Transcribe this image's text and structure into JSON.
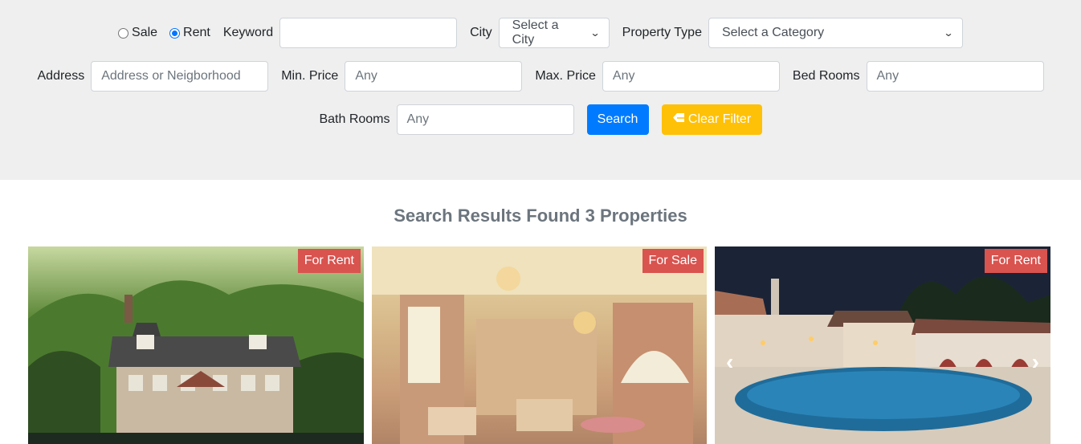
{
  "filters": {
    "sale_label": "Sale",
    "rent_label": "Rent",
    "selected_listing": "Rent",
    "keyword_label": "Keyword",
    "keyword_value": "",
    "city_label": "City",
    "city_selected": "Select a City",
    "property_type_label": "Property Type",
    "property_type_selected": "Select a Category",
    "address_label": "Address",
    "address_placeholder": "Address or Neigborhood",
    "min_price_label": "Min. Price",
    "min_price_placeholder": "Any",
    "max_price_label": "Max. Price",
    "max_price_placeholder": "Any",
    "bed_rooms_label": "Bed Rooms",
    "bed_rooms_placeholder": "Any",
    "bath_rooms_label": "Bath Rooms",
    "bath_rooms_placeholder": "Any",
    "search_button": "Search",
    "clear_button": "Clear Filter"
  },
  "results": {
    "title": "Search Results Found 3 Properties",
    "cards": [
      {
        "badge": "For Rent"
      },
      {
        "badge": "For Sale"
      },
      {
        "badge": "For Rent",
        "prev": "‹",
        "next": "›"
      }
    ]
  },
  "colors": {
    "primary": "#007bff",
    "warning": "#ffc107",
    "badge": "#d9534f",
    "panel_bg": "#efefef",
    "title_text": "#6c757d"
  }
}
